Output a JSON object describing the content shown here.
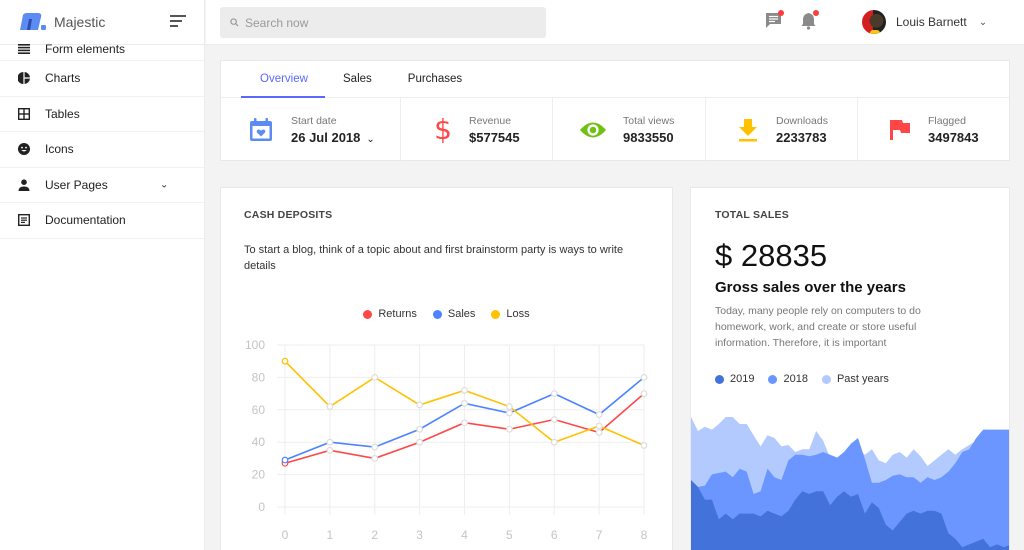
{
  "brand": {
    "name": "Majestic"
  },
  "sidebar": {
    "items": [
      {
        "label": "Form elements",
        "icon": "list-icon"
      },
      {
        "label": "Charts",
        "icon": "pie-chart-icon"
      },
      {
        "label": "Tables",
        "icon": "grid-icon"
      },
      {
        "label": "Icons",
        "icon": "smile-icon"
      },
      {
        "label": "User Pages",
        "icon": "user-icon",
        "expandable": true
      },
      {
        "label": "Documentation",
        "icon": "document-icon"
      }
    ]
  },
  "topbar": {
    "search_placeholder": "Search now",
    "user_name": "Louis Barnett"
  },
  "tabs": [
    {
      "label": "Overview",
      "active": true
    },
    {
      "label": "Sales"
    },
    {
      "label": "Purchases"
    }
  ],
  "stats": [
    {
      "label": "Start date",
      "value": "26 Jul 2018",
      "icon": "calendar-icon",
      "color": "#5d8bf4"
    },
    {
      "label": "Revenue",
      "value": "$577545",
      "icon": "dollar-icon",
      "color": "#ff4747"
    },
    {
      "label": "Total views",
      "value": "9833550",
      "icon": "eye-icon",
      "color": "#71c016"
    },
    {
      "label": "Downloads",
      "value": "2233783",
      "icon": "download-icon",
      "color": "#ffc100"
    },
    {
      "label": "Flagged",
      "value": "3497843",
      "icon": "flag-icon",
      "color": "#ff4747"
    }
  ],
  "cash_deposits": {
    "title": "CASH DEPOSITS",
    "description": "To start a blog, think of a topic about and first brainstorm party is ways to write details"
  },
  "total_sales": {
    "title": "TOTAL SALES",
    "amount": "$ 28835",
    "heading": "Gross sales over the years",
    "description": "Today, many people rely on computers to do homework, work, and create or store useful information. Therefore, it is important",
    "legend": [
      {
        "label": "2019",
        "color": "#4472db"
      },
      {
        "label": "2018",
        "color": "#6b96ff"
      },
      {
        "label": "Past years",
        "color": "#b3caff"
      }
    ]
  },
  "chart_data": [
    {
      "type": "line",
      "title": "CASH DEPOSITS",
      "x": [
        0,
        1,
        2,
        3,
        4,
        5,
        6,
        7,
        8
      ],
      "ylim": [
        0,
        100
      ],
      "yticks": [
        0,
        20,
        40,
        60,
        80,
        100
      ],
      "grid": true,
      "legend": "top-center",
      "series": [
        {
          "name": "Returns",
          "color": "#ff4747",
          "values": [
            27,
            35,
            30,
            40,
            52,
            48,
            54,
            46,
            70
          ]
        },
        {
          "name": "Sales",
          "color": "#4d83ff",
          "values": [
            29,
            40,
            37,
            48,
            64,
            58,
            70,
            57,
            80
          ]
        },
        {
          "name": "Loss",
          "color": "#ffc100",
          "values": [
            90,
            62,
            80,
            63,
            72,
            62,
            40,
            50,
            38
          ]
        }
      ]
    },
    {
      "type": "area",
      "title": "TOTAL SALES",
      "legend": "top-left",
      "ylim": [
        0,
        100
      ],
      "series": [
        {
          "name": "Past years",
          "color": "#b3caff",
          "values": [
            95,
            85,
            88,
            86,
            90,
            95,
            95,
            90,
            90,
            82,
            74,
            82,
            80,
            74,
            75,
            70,
            72,
            72,
            85,
            78,
            66,
            64,
            68,
            72,
            72,
            68,
            72,
            64,
            62,
            68,
            70,
            66,
            72,
            67,
            60,
            64,
            68,
            72,
            68,
            72,
            75,
            78,
            75,
            74,
            78,
            80,
            80
          ]
        },
        {
          "name": "2018",
          "color": "#6b96ff",
          "values": [
            50,
            45,
            46,
            54,
            55,
            56,
            52,
            58,
            56,
            40,
            42,
            58,
            52,
            50,
            64,
            68,
            68,
            67,
            68,
            70,
            68,
            66,
            70,
            76,
            80,
            65,
            48,
            48,
            50,
            53,
            54,
            52,
            52,
            48,
            52,
            50,
            52,
            56,
            62,
            70,
            72,
            80,
            86,
            86,
            86,
            86,
            86
          ]
        },
        {
          "name": "2019",
          "color": "#4472db",
          "values": [
            50,
            45,
            36,
            36,
            22,
            26,
            22,
            26,
            26,
            26,
            24,
            28,
            26,
            24,
            28,
            36,
            42,
            40,
            42,
            42,
            32,
            38,
            42,
            38,
            40,
            26,
            34,
            30,
            18,
            14,
            20,
            26,
            28,
            26,
            28,
            28,
            26,
            12,
            8,
            2,
            4,
            6,
            8,
            2,
            4,
            2,
            4
          ]
        }
      ]
    }
  ]
}
